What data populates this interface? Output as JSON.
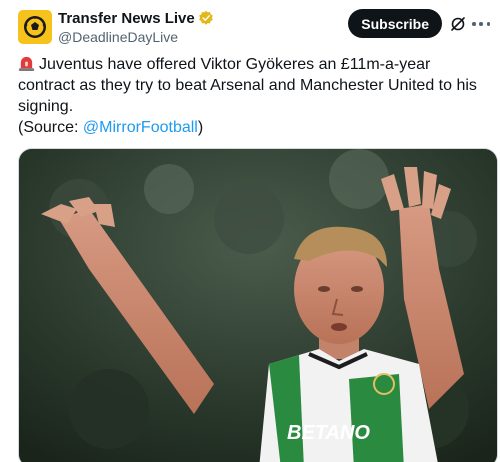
{
  "account": {
    "display_name": "Transfer News Live",
    "handle": "@DeadlineDayLive",
    "verified": true,
    "avatar_icon": "football-logo-icon",
    "avatar_color": "#f7c21b"
  },
  "actions": {
    "subscribe_label": "Subscribe",
    "grok_icon": "grok-icon",
    "more_icon": "more-dots-icon"
  },
  "tweet": {
    "emoji": "siren-emoji",
    "text": "Juventus have offered Viktor Gyökeres an £11m-a-year contract as they try to beat Arsenal and Manchester United to his signing.",
    "source_prefix": "(Source: ",
    "source_mention": "@MirrorFootball",
    "source_suffix": ")"
  },
  "media": {
    "description_icon": "player-photo",
    "kit_sponsor": "BETANO"
  },
  "colors": {
    "accent": "#1d9bf0",
    "text": "#0f1419",
    "secondary": "#536471",
    "verified": "#e2b719"
  }
}
